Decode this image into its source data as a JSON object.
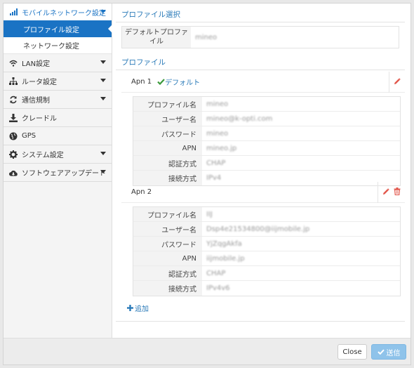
{
  "sidebar": {
    "top": {
      "label": "モバイルネットワーク設定",
      "icon": "signal-bars-icon"
    },
    "sub": [
      {
        "label": "プロファイル設定",
        "active": true
      },
      {
        "label": "ネットワーク設定",
        "active": false
      }
    ],
    "items": [
      {
        "label": "LAN設定",
        "icon": "wifi-icon",
        "has_caret": true
      },
      {
        "label": "ルータ設定",
        "icon": "network-tree-icon",
        "has_caret": true
      },
      {
        "label": "通信規制",
        "icon": "refresh-icon",
        "has_caret": true
      },
      {
        "label": "クレードル",
        "icon": "download-icon",
        "has_caret": false
      },
      {
        "label": "GPS",
        "icon": "globe-icon",
        "has_caret": false
      },
      {
        "label": "システム設定",
        "icon": "gear-icon",
        "has_caret": true
      },
      {
        "label": "ソフトウェアアップデート",
        "icon": "cloud-download-icon",
        "has_caret": true
      }
    ]
  },
  "main": {
    "profile_select_title": "プロファイル選択",
    "default_profile": {
      "label": "デフォルトプロファイル",
      "value": "mineo"
    },
    "profile_title": "プロファイル",
    "apns": [
      {
        "name": "Apn 1",
        "default_label": "デフォルト",
        "is_default": true,
        "fields": [
          {
            "label": "プロファイル名",
            "value": "mineo"
          },
          {
            "label": "ユーザー名",
            "value": "mineo@k-opti.com"
          },
          {
            "label": "パスワード",
            "value": "mineo"
          },
          {
            "label": "APN",
            "value": "mineo.jp"
          },
          {
            "label": "認証方式",
            "value": "CHAP"
          },
          {
            "label": "接続方式",
            "value": "IPv4"
          }
        ]
      },
      {
        "name": "Apn 2",
        "default_label": "",
        "is_default": false,
        "fields": [
          {
            "label": "プロファイル名",
            "value": "IIJ"
          },
          {
            "label": "ユーザー名",
            "value": "Dsp4e21534800@iijmobile.jp"
          },
          {
            "label": "パスワード",
            "value": "YjZqgAkfa"
          },
          {
            "label": "APN",
            "value": "iijmobile.jp"
          },
          {
            "label": "認証方式",
            "value": "CHAP"
          },
          {
            "label": "接続方式",
            "value": "IPv4v6"
          }
        ]
      }
    ],
    "add_label": "追加"
  },
  "footer": {
    "close_label": "Close",
    "send_label": "送信"
  },
  "colors": {
    "accent": "#1a73c4",
    "link": "#2a7ab8",
    "check": "#3c9a3c",
    "danger": "#e2574c",
    "send_button": "#8fc3ea"
  }
}
